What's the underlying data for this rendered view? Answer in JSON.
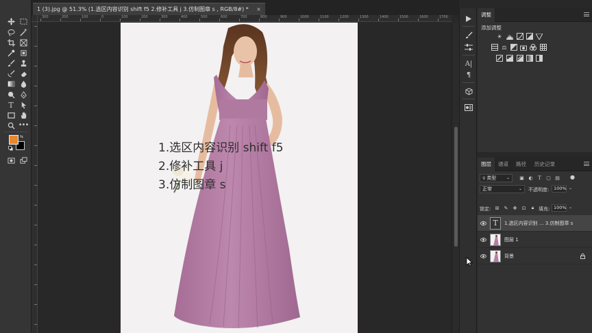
{
  "document": {
    "tab_title": "1 (3).jpg @ 51.3% (1.选区内容识别   shift f5 2.修补工具 j 3.仿制图章 s , RGB/8#) *",
    "close_glyph": "×"
  },
  "ruler": {
    "top_ticks": [
      "300",
      "200",
      "100",
      "0",
      "100",
      "200",
      "300",
      "400",
      "500",
      "600",
      "700",
      "800",
      "900",
      "1000",
      "1100",
      "1200",
      "1300",
      "1400",
      "1500",
      "1600",
      "1700"
    ]
  },
  "canvas": {
    "photo_background": "#f3f1f2",
    "dress_color": "#b57fa5",
    "overlay_lines": [
      "1.选区内容识别   shift f5",
      "2.修补工具 j",
      "3.仿制图章 s"
    ]
  },
  "toolbar": {
    "foreground_color": "#e8872e",
    "background_color": "#000000"
  },
  "adjustments_panel": {
    "tab": "调整",
    "add_label": "添加调整"
  },
  "layers_panel": {
    "tabs": [
      "图层",
      "通道",
      "路径",
      "历史记录"
    ],
    "filter_label": "类型",
    "blend_mode": "正常",
    "opacity_label": "不透明度:",
    "opacity_value": "100%",
    "lock_label": "锁定:",
    "fill_label": "填充:",
    "fill_value": "100%",
    "layers": [
      {
        "name": "1.选区内容识别   ... 3.仿制图章 s",
        "kind": "text",
        "selected": true,
        "visible": true
      },
      {
        "name": "图层 1",
        "kind": "image",
        "selected": false,
        "visible": true
      },
      {
        "name": "背景",
        "kind": "image",
        "selected": false,
        "visible": true,
        "locked": true
      }
    ]
  },
  "colors": {
    "ui_dark": "#282828",
    "panel": "#323232",
    "selected_row": "#454545",
    "accent_orange": "#e8872e"
  }
}
